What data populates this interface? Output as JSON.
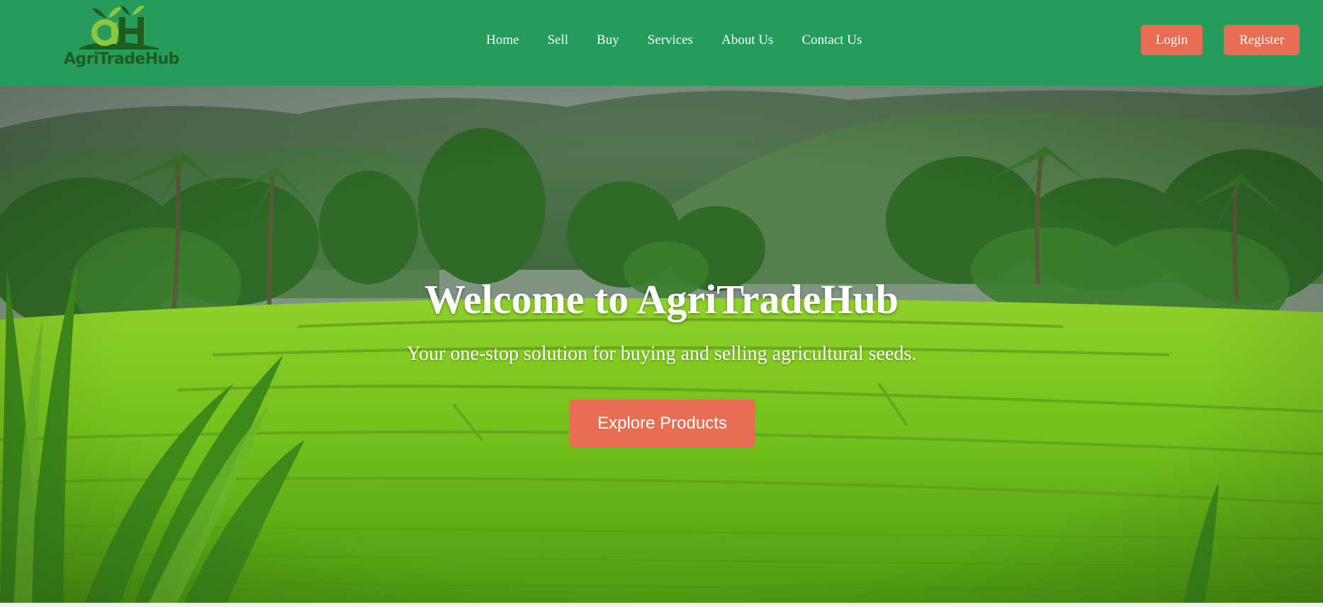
{
  "brand": {
    "logo_text": "AgriTradeHub",
    "colors": {
      "header": "#259b5c",
      "accent": "#e76e55",
      "logo_dark": "#1d5e1f",
      "logo_light": "#8dc63f"
    }
  },
  "nav": {
    "items": [
      {
        "label": "Home"
      },
      {
        "label": "Sell"
      },
      {
        "label": "Buy"
      },
      {
        "label": "Services"
      },
      {
        "label": "About Us"
      },
      {
        "label": "Contact Us"
      }
    ]
  },
  "auth": {
    "login_label": "Login",
    "register_label": "Register"
  },
  "hero": {
    "title": "Welcome to AgriTradeHub",
    "subtitle": "Your one-stop solution for buying and selling agricultural seeds.",
    "cta_label": "Explore Products",
    "background": "rice-terrace-photo"
  }
}
